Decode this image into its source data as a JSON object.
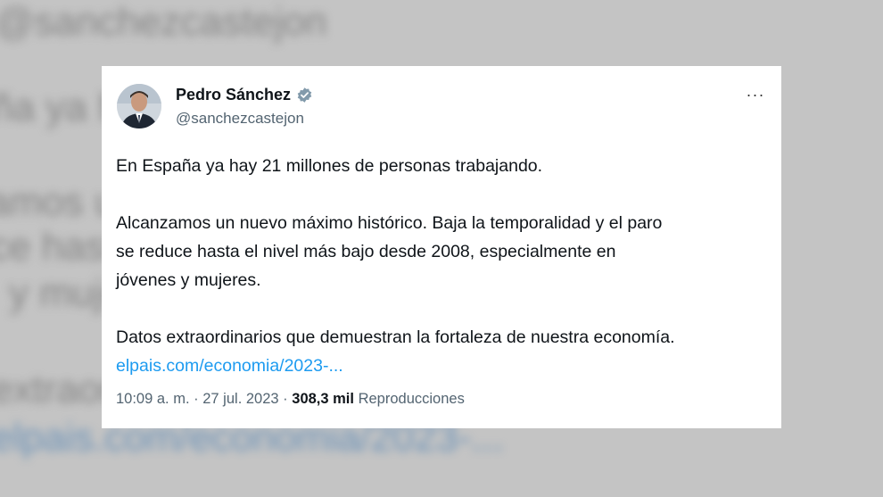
{
  "background": {
    "lines": [
      "@sanchezcastejon",
      "ña ya h",
      "amos u                                                    dad y el",
      "ce hasta                                                  enta en",
      "y muje",
      "extraord                                                   stra eco"
    ],
    "link": "elpais.com/economia/2023-..."
  },
  "tweet": {
    "author_name": "Pedro Sánchez",
    "handle": "@sanchezcastejon",
    "more_label": "···",
    "paragraphs": [
      "En España ya hay 21 millones de personas trabajando.",
      "Alcanzamos un nuevo máximo histórico. Baja la temporalidad y el paro\nse reduce hasta el nivel más bajo desde 2008, especialmente en\njóvenes y mujeres.",
      "Datos extraordinarios que demuestran la fortaleza de nuestra economía."
    ],
    "link_text": "elpais.com/economia/2023-...",
    "time": "10:09 a. m.",
    "date": "27 jul. 2023",
    "views_count": "308,3 mil",
    "views_label": "Reproducciones",
    "separator": "·"
  },
  "colors": {
    "link": "#1d9bf0",
    "verified_badge": "#829aab",
    "secondary_text": "#536471",
    "primary_text": "#0f1419"
  }
}
